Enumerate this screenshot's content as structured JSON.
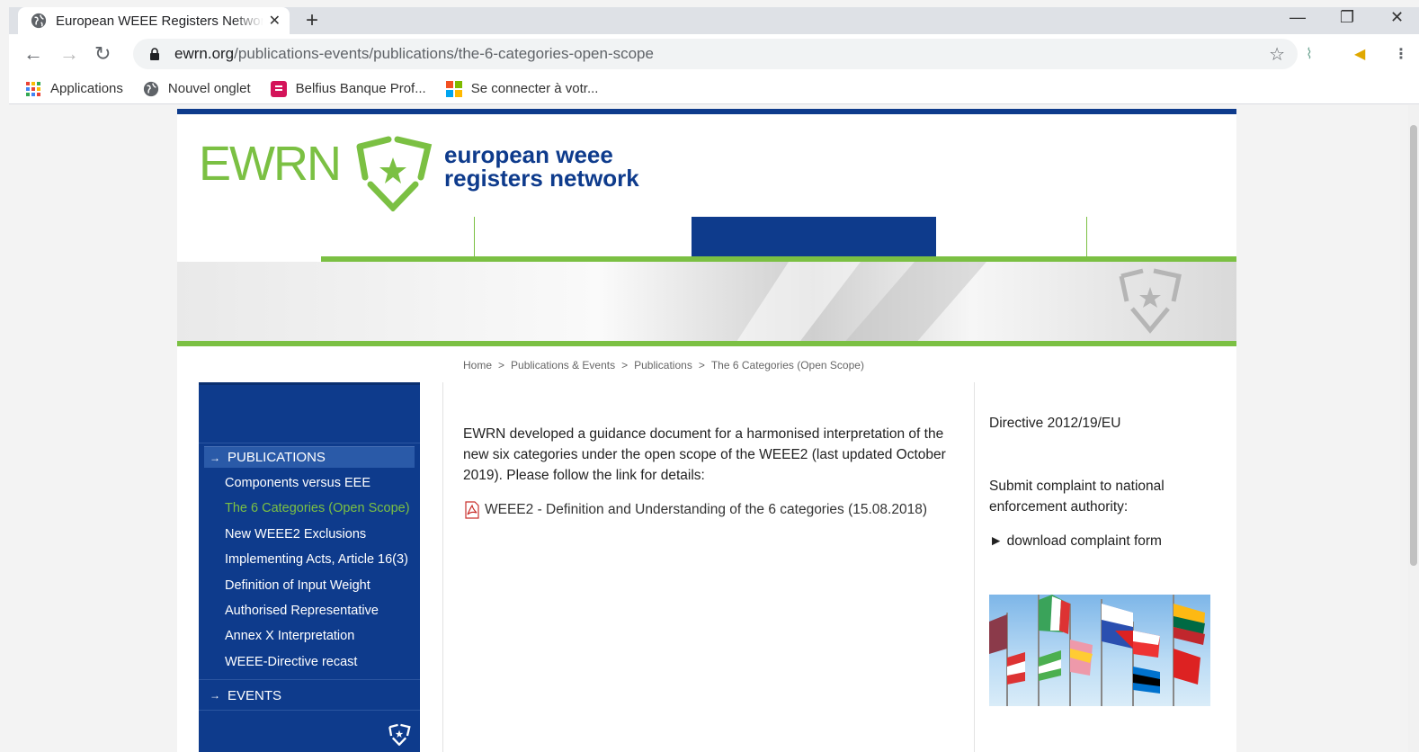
{
  "browser": {
    "tab_title": "European WEEE Registers Network",
    "url_domain": "ewrn.org",
    "url_path": "/publications-events/publications/the-6-categories-open-scope",
    "bookmarks": [
      "Applications",
      "Nouvel onglet",
      "Belfius Banque Prof...",
      "Se connecter à votr..."
    ]
  },
  "logo": {
    "abbr": "EWRN",
    "line1": "european weee",
    "line2": "registers network"
  },
  "breadcrumb": [
    "Home",
    "Publications & Events",
    "Publications",
    "The 6 Categories (Open Scope)"
  ],
  "sidebar": {
    "section1": "PUBLICATIONS",
    "items": [
      "Components versus EEE",
      "The 6 Categories (Open Scope)",
      "New WEEE2 Exclusions",
      "Implementing Acts, Article 16(3)",
      "Definition of Input Weight",
      "Authorised Representative",
      "Annex X Interpretation",
      "WEEE-Directive recast"
    ],
    "section2": "EVENTS"
  },
  "main": {
    "intro": "EWRN developed a guidance document for a harmonised interpretation of the new six categories under the open scope of the WEEE2 (last updated October 2019).  Please follow the link for details:",
    "pdf_link": "WEEE2 - Definition and Understanding of the 6 categories (15.08.2018)"
  },
  "right": {
    "directive": "Directive 2012/19/EU",
    "complaint": "Submit complaint to national enforcement authority:",
    "download": "► download complaint form"
  },
  "colors": {
    "green": "#7bc043",
    "navy": "#0e3b8c"
  }
}
